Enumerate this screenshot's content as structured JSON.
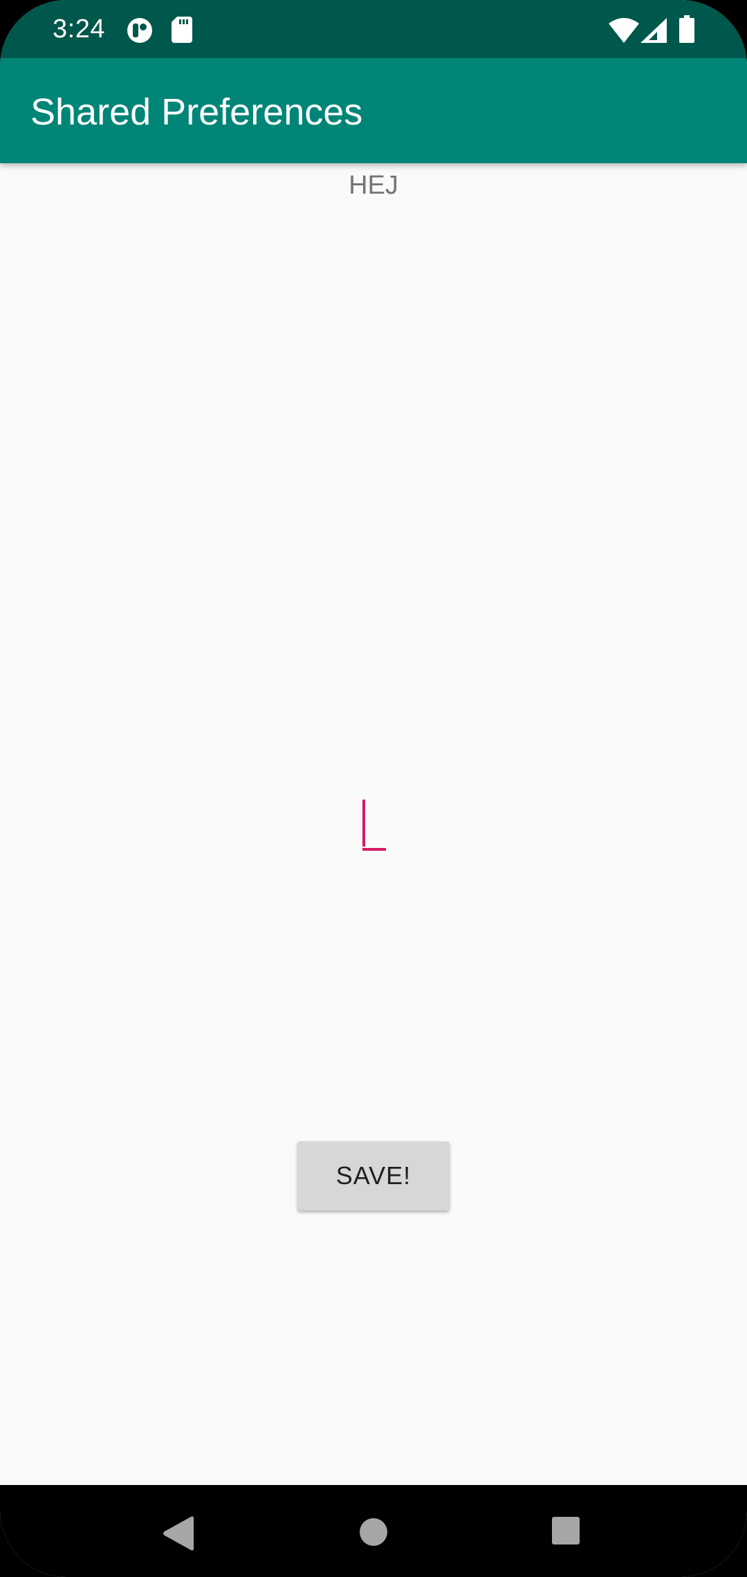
{
  "status_bar": {
    "time": "3:24",
    "icons": [
      "app-notification-icon",
      "sd-card-icon",
      "wifi-icon",
      "signal-icon",
      "battery-icon"
    ]
  },
  "app_bar": {
    "title": "Shared Preferences"
  },
  "main": {
    "label": "HEJ",
    "edit_text_value": "",
    "save_button_label": "SAVE!"
  },
  "nav_bar": {
    "buttons": [
      "back-icon",
      "home-icon",
      "recents-icon"
    ]
  },
  "colors": {
    "status_bar": "#00574b",
    "app_bar": "#008577",
    "accent": "#d81b60",
    "background": "#fafafa",
    "button": "#d6d7d7"
  }
}
